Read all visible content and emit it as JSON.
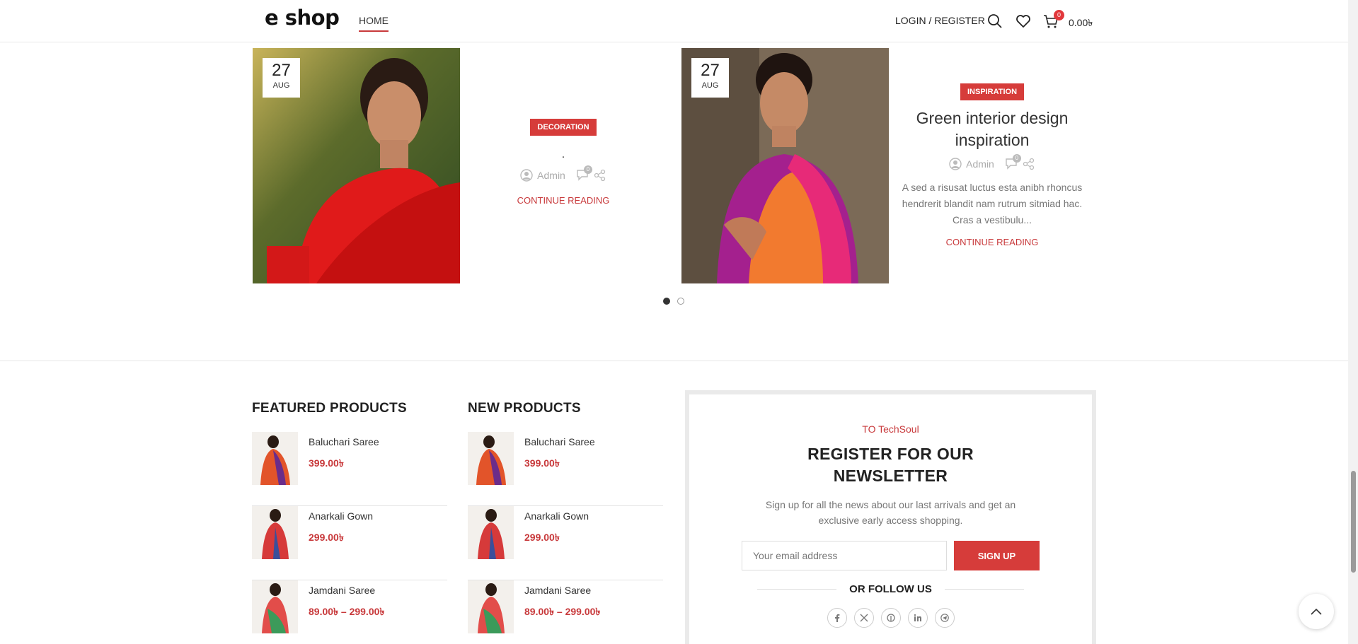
{
  "header": {
    "logo": "e shop",
    "nav_home": "HOME",
    "login": "LOGIN / REGISTER",
    "cart_count": "0",
    "cart_total": "0.00৳"
  },
  "posts": [
    {
      "day": "27",
      "month": "AUG",
      "category": "DECORATION",
      "title": ".",
      "author": "Admin",
      "comments": "0",
      "excerpt": "",
      "continue": "CONTINUE READING"
    },
    {
      "day": "27",
      "month": "AUG",
      "category": "INSPIRATION",
      "title": "Green interior design inspiration",
      "author": "Admin",
      "comments": "0",
      "excerpt": "A sed a risusat luctus esta anibh rhoncus hendrerit blandit nam rutrum sitmiad hac. Cras a vestibulu...",
      "continue": "CONTINUE READING"
    }
  ],
  "featured": {
    "title": "FEATURED PRODUCTS",
    "items": [
      {
        "name": "Baluchari Saree",
        "price": "399.00৳"
      },
      {
        "name": "Anarkali Gown",
        "price": "299.00৳"
      },
      {
        "name": "Jamdani Saree",
        "price": "89.00৳  – 299.00৳"
      }
    ]
  },
  "new_products": {
    "title": "NEW PRODUCTS",
    "items": [
      {
        "name": "Baluchari Saree",
        "price": "399.00৳"
      },
      {
        "name": "Anarkali Gown",
        "price": "299.00৳"
      },
      {
        "name": "Jamdani Saree",
        "price": "89.00৳  – 299.00৳"
      }
    ]
  },
  "newsletter": {
    "subtitle": "TO TechSoul",
    "title": "REGISTER FOR OUR NEWSLETTER",
    "description": "Sign up for all the news about our last arrivals and get an exclusive early access shopping.",
    "email_placeholder": "Your email address",
    "signup": "SIGN UP",
    "follow": "OR FOLLOW US",
    "socials": [
      "facebook-icon",
      "x-icon",
      "pinterest-icon",
      "linkedin-icon",
      "telegram-icon"
    ]
  },
  "colors": {
    "accent": "#d63c3a",
    "price": "#c8393b"
  }
}
